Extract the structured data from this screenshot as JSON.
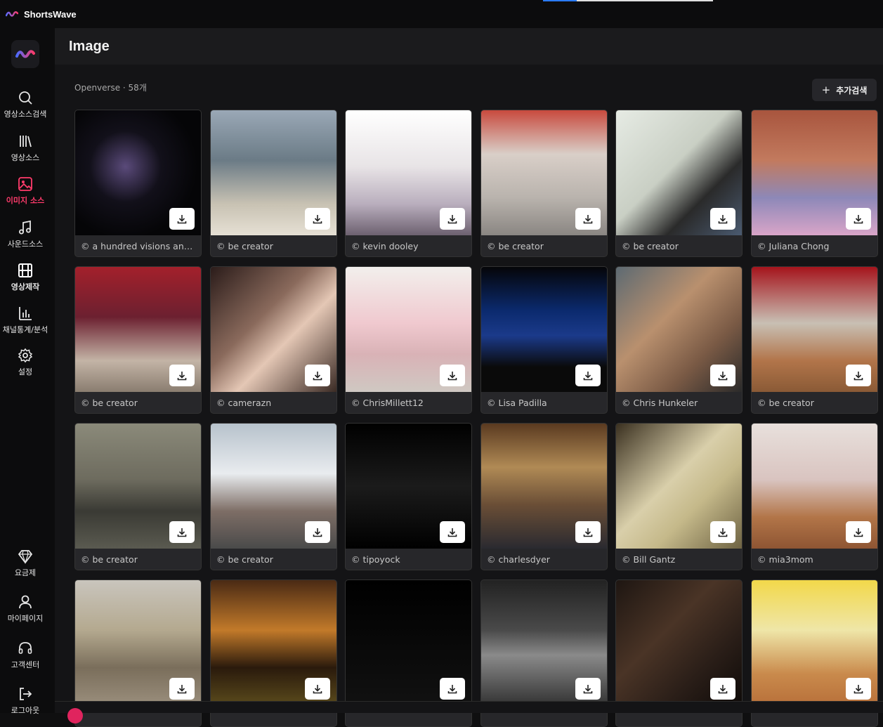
{
  "app": {
    "name": "ShortsWave"
  },
  "sidebar": {
    "items": [
      {
        "label": "영상소스검색",
        "icon": "search-icon"
      },
      {
        "label": "영상소스",
        "icon": "library-icon"
      },
      {
        "label": "이미지 소스",
        "icon": "image-icon",
        "active": true
      },
      {
        "label": "사운드소스",
        "icon": "music-icon"
      },
      {
        "label": "영상제작",
        "icon": "film-icon"
      },
      {
        "label": "채널통계/분석",
        "icon": "bar-chart-icon"
      },
      {
        "label": "설정",
        "icon": "gear-icon"
      }
    ],
    "bottom_items": [
      {
        "label": "요금제",
        "icon": "diamond-icon"
      },
      {
        "label": "마이페이지",
        "icon": "user-icon"
      },
      {
        "label": "고객센터",
        "icon": "headset-icon"
      },
      {
        "label": "로그아웃",
        "icon": "logout-icon"
      }
    ]
  },
  "header": {
    "title": "Image"
  },
  "results": {
    "summary": "Openverse · 58개",
    "add_search_label": "추가검색"
  },
  "images": [
    {
      "credit": "© a hundred visions and revisions"
    },
    {
      "credit": "© be creator"
    },
    {
      "credit": "© kevin dooley"
    },
    {
      "credit": "© be creator"
    },
    {
      "credit": "© be creator"
    },
    {
      "credit": "© Juliana Chong"
    },
    {
      "credit": "© be creator"
    },
    {
      "credit": "© camerazn"
    },
    {
      "credit": "© ChrisMillett12"
    },
    {
      "credit": "© Lisa Padilla"
    },
    {
      "credit": "© Chris Hunkeler"
    },
    {
      "credit": "© be creator"
    },
    {
      "credit": "© be creator"
    },
    {
      "credit": "© be creator"
    },
    {
      "credit": "© tipoyock"
    },
    {
      "credit": "© charlesdyer"
    },
    {
      "credit": "© Bill Gantz"
    },
    {
      "credit": "© mia3mom"
    },
    {
      "credit": ""
    },
    {
      "credit": ""
    },
    {
      "credit": ""
    },
    {
      "credit": ""
    },
    {
      "credit": ""
    },
    {
      "credit": ""
    }
  ],
  "colors": {
    "accent": "#ff3b6b",
    "background": "#141416",
    "sidebar": "#0c0c0d"
  }
}
